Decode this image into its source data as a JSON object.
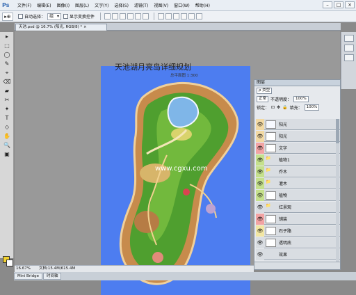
{
  "app": {
    "logo": "Ps",
    "menus": [
      "文件(F)",
      "编辑(E)",
      "图像(I)",
      "图层(L)",
      "文字(Y)",
      "选择(S)",
      "滤镜(T)",
      "视图(V)",
      "窗口(W)",
      "帮助(H)"
    ],
    "window_buttons": [
      "–",
      "□",
      "×"
    ]
  },
  "options": {
    "tool_icon": "▸⊕",
    "auto_select_label": "自动选择：",
    "auto_select_value": "组",
    "show_transform_label": "显示变换控件"
  },
  "tools": [
    "▸",
    "⬚",
    "◯",
    "✎",
    "⌖",
    "⌫",
    "▰",
    "✂",
    "✦",
    "T",
    "◇",
    "✋",
    "🔍",
    "▣"
  ],
  "document": {
    "tab_title": "天池.psd @ 16.7% (阳光, RGB/8) * ×",
    "zoom": "16.67%",
    "doc_size": "文档:15.4M/615.4M"
  },
  "map": {
    "title": "天池湖月亮岛详细规划",
    "subtitle": "总平面图 1:300",
    "watermark": "www.cgxu.com"
  },
  "bottom_tabs": [
    "Mini Bridge",
    "时间轴"
  ],
  "layers": {
    "panel_title": "图层",
    "filter": "ρ 类型",
    "blend": "正常",
    "opacity_label": "不透明度：",
    "opacity": "100%",
    "lock_label": "锁定：",
    "fill_label": "填充：",
    "fill": "100%",
    "items": [
      {
        "name": "阳光",
        "color": "#f2d9a3",
        "thumb": "#f7f9ff"
      },
      {
        "name": "阳光",
        "color": "#f2d9a3",
        "thumb": "#ffffff"
      },
      {
        "name": "文字",
        "color": "#f2a3a3",
        "thumb": "#ffffff"
      },
      {
        "name": "植物1",
        "color": "#c5e08c",
        "thumb": "folder"
      },
      {
        "name": "乔木",
        "color": "#c5e08c",
        "thumb": "folder"
      },
      {
        "name": "灌木",
        "color": "#c5e08c",
        "thumb": "folder"
      },
      {
        "name": "植物",
        "color": "#c5e08c",
        "thumb": "#ffffff"
      },
      {
        "name": "红景观",
        "color": "#d9dde2",
        "thumb": "folder"
      },
      {
        "name": "铺装",
        "color": "#f2a3a3",
        "thumb": "#ffffff"
      },
      {
        "name": "石子路",
        "color": "#f2e6a3",
        "thumb": "#ffffff"
      },
      {
        "name": "透明底",
        "color": "#d9dde2",
        "thumb": "#ffffff"
      },
      {
        "name": "效果",
        "color": "#d9dde2",
        "thumb": "none"
      }
    ]
  }
}
